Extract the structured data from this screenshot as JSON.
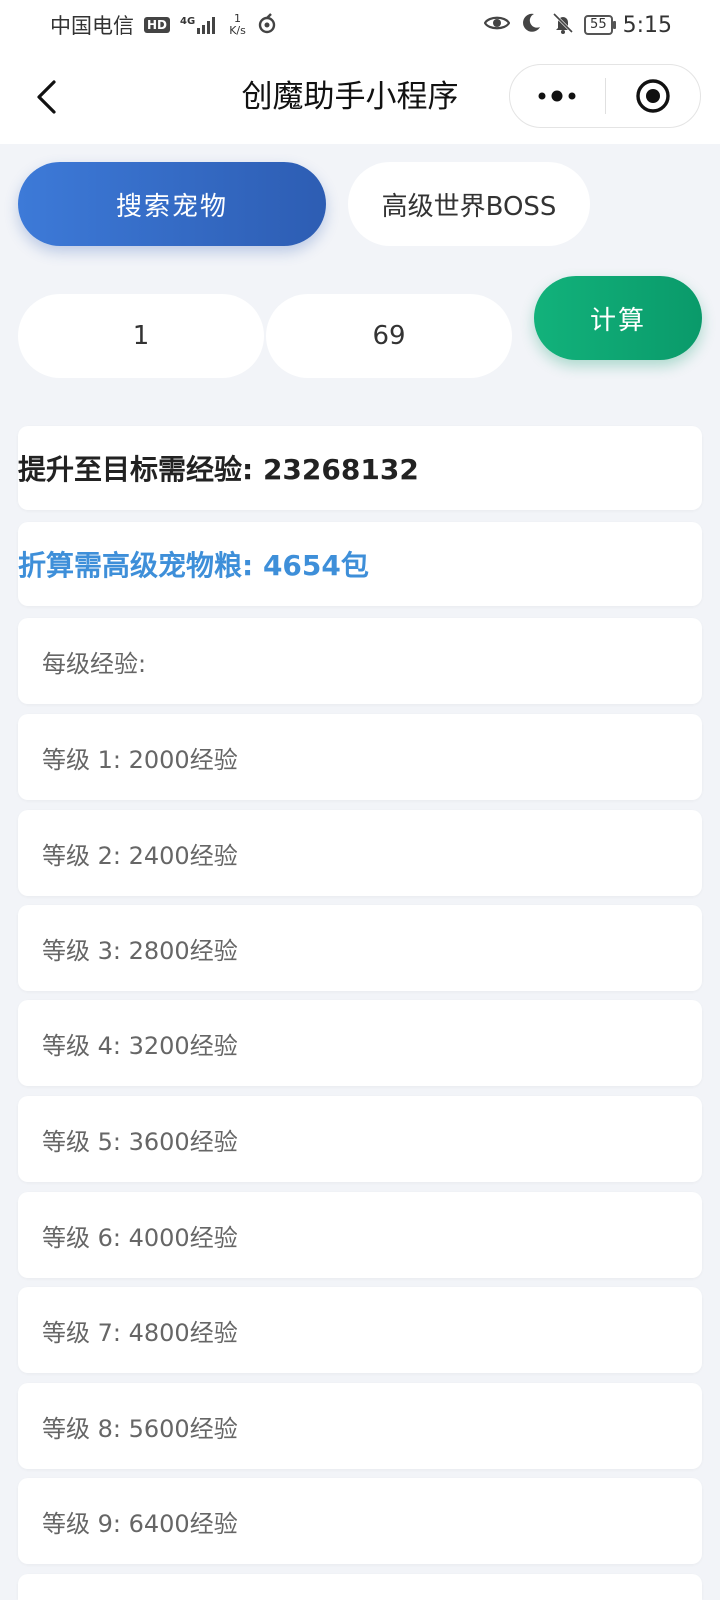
{
  "status_bar": {
    "carrier": "中国电信",
    "hd": "HD",
    "signal": "4G",
    "net_speed_value": "1",
    "net_speed_unit": "K/s",
    "battery": "55",
    "time": "5:15"
  },
  "nav": {
    "title": "创魔助手小程序"
  },
  "tabs": [
    {
      "label": "搜索宠物",
      "active": true
    },
    {
      "label": "高级世界BOSS",
      "active": false
    }
  ],
  "calculator": {
    "from_level": "1",
    "to_level": "69",
    "calc_label": "计算"
  },
  "results": {
    "exp_needed": "提升至目标需经验: 23268132",
    "food_needed": "折算需高级宠物粮: 4654包",
    "per_level_title": "每级经验:",
    "levels": [
      "等级 1: 2000经验",
      "等级 2: 2400经验",
      "等级 3: 2800经验",
      "等级 4: 3200经验",
      "等级 5: 3600经验",
      "等级 6: 4000经验",
      "等级 7: 4800经验",
      "等级 8: 5600经验",
      "等级 9: 6400经验",
      ""
    ]
  },
  "colors": {
    "tab_active": "#3d7ad8",
    "calc_button": "#12b27b",
    "food_text": "#3e8fd9",
    "background": "#f2f4f8"
  }
}
